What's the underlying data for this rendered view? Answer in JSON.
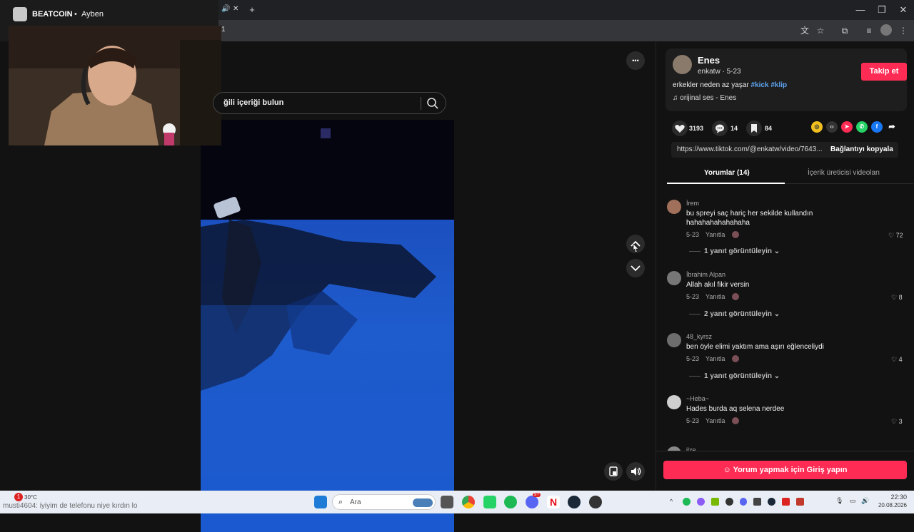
{
  "browser": {
    "tab_label": "BEATCOIN",
    "tab_sublabel": "Ayben",
    "close_glyph": "✕",
    "new_tab_glyph": "+",
    "minimize_glyph": "—",
    "restore_glyph": "❐",
    "window_close_glyph": "✕",
    "address_text": "1"
  },
  "search": {
    "placeholder": "ğili içeriği bulun"
  },
  "more_glyph": "•••",
  "author": {
    "name": "Enes",
    "handle_date": "enkatw · 5-23",
    "follow_label": "Takip et",
    "caption": "erkekler neden az yaşar",
    "tags": "#kick #klip",
    "sound": "orijinal ses - Enes"
  },
  "stats": {
    "likes": "3193",
    "comments": "14",
    "saves": "84"
  },
  "share": {
    "url": "https://www.tiktok.com/@enkatw/video/7643...",
    "copy_label": "Bağlantıyı kopyala"
  },
  "tabs": {
    "comments": "Yorumlar (14)",
    "creator_videos": "İçerik üreticisi videoları"
  },
  "comments": [
    {
      "user": "İrem",
      "text": "bu spreyi saç hariç her sekilde kullandın hahahahahahahaha",
      "date": "5-23",
      "reply": "Yanıtla",
      "likes": "72",
      "replies": "1 yanıt görüntüleyin"
    },
    {
      "user": "İbrahim Alpan",
      "text": "Allah akıl fikir versin",
      "date": "5-23",
      "reply": "Yanıtla",
      "likes": "8",
      "replies": "2 yanıt görüntüleyin"
    },
    {
      "user": "48_kyrsz",
      "text": "ben öyle elimi yaktım ama aşırı eğlenceliydi",
      "date": "5-23",
      "reply": "Yanıtla",
      "likes": "4",
      "replies": "1 yanıt görüntüleyin"
    },
    {
      "user": "~Heba~",
      "text": "Hades burda aq selena nerdee",
      "date": "5-23",
      "reply": "Yanıtla",
      "likes": "3",
      "replies": ""
    },
    {
      "user": "ilze",
      "text": "",
      "date": "",
      "reply": "",
      "likes": "",
      "replies": ""
    }
  ],
  "login_label": "Yorum yapmak için Giriş yapın",
  "taskbar": {
    "weather_temp": "30°C",
    "notification_count": "1",
    "ticker_text": "musti4604: iyiyim de telefonu niye kırdın lo",
    "search_label": "Ara",
    "time": "22:30",
    "date": "20.08.2026",
    "discord_badge": "9+"
  },
  "colors": {
    "accent": "#fe2c55",
    "hashtag": "#5ea5f2",
    "video_blue": "#1f5ccc"
  }
}
